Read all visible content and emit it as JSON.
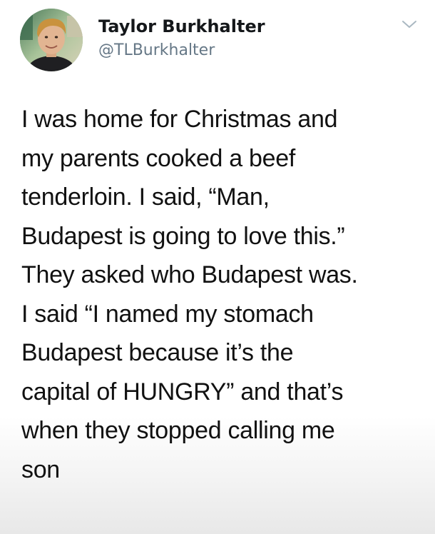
{
  "tweet": {
    "author": {
      "display_name": "Taylor Burkhalter",
      "handle": "@TLBurkhalter",
      "avatar_icon": "profile-photo"
    },
    "menu_icon": "chevron-down-icon",
    "body_lines": [
      "I was home for Christmas and",
      "my parents cooked a beef",
      "tenderloin. I said, “Man,",
      "Budapest is going to love this.”",
      "They asked who Budapest was.",
      "I said “I named my stomach",
      "Budapest because it’s the",
      "capital of HUNGRY” and that’s",
      "when they stopped calling me",
      "son"
    ]
  },
  "colors": {
    "text": "#111111",
    "handle": "#657786",
    "name": "#14171a",
    "chevron": "#aab8c2"
  }
}
